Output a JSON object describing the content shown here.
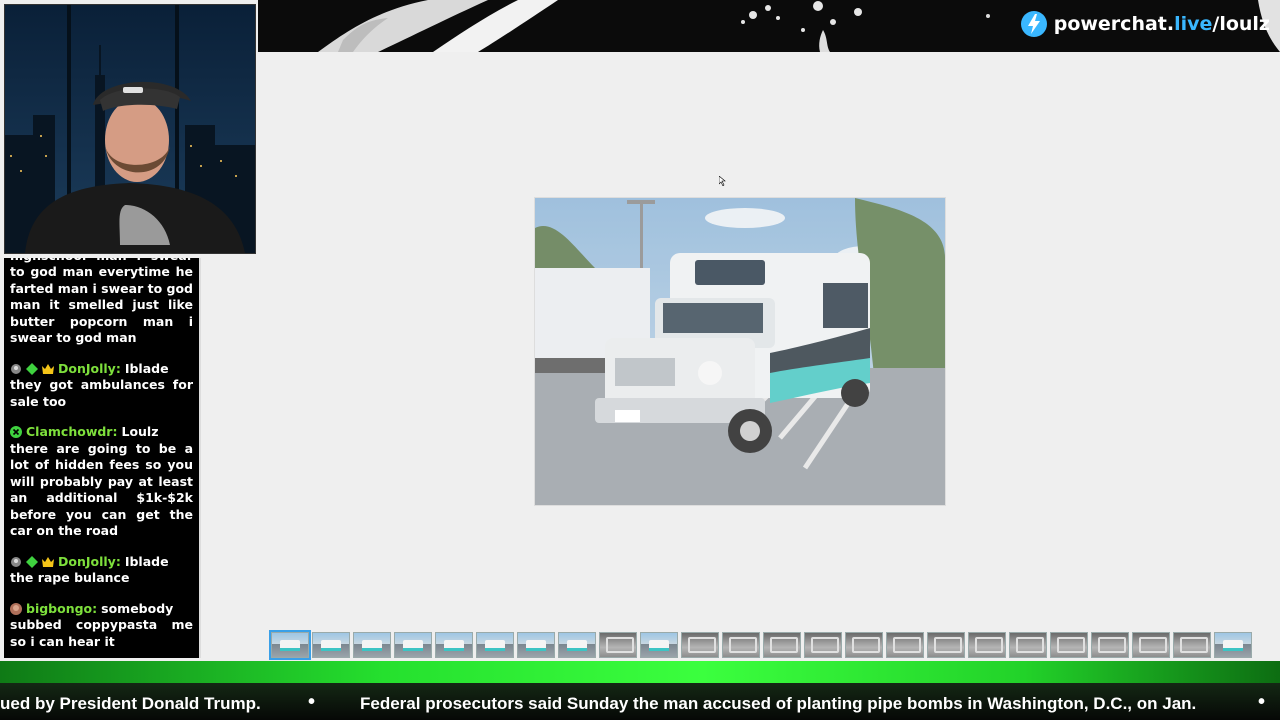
{
  "banner": {
    "brand_text_main": "powerchat.",
    "brand_text_live": "live",
    "brand_text_path": "/loulz",
    "brand_color": "#3ab7ff"
  },
  "chat": {
    "messages": [
      {
        "user": "",
        "text": "highschool man i swear to god man everytime he farted man i swear to god man it smelled just like butter popcorn man i swear to god man",
        "color": "#ffffff",
        "badges": []
      },
      {
        "user": "DonJolly:",
        "text": "Iblade they got ambulances for sale too",
        "color": "#7ee03c",
        "badges": [
          "mod-icon",
          "diamond-icon",
          "crown-icon"
        ]
      },
      {
        "user": "Clamchowdr:",
        "text": "Loulz there are going to be a lot of hidden fees so you will probably pay at least an additional $1k-$2k before you can get the car on the road",
        "color": "#7ee03c",
        "badges": [
          "x-circle-icon"
        ]
      },
      {
        "user": "DonJolly:",
        "text": "Iblade the rape bulance",
        "color": "#7ee03c",
        "badges": [
          "mod-icon",
          "diamond-icon",
          "crown-icon"
        ]
      },
      {
        "user": "bigbongo:",
        "text": "somebody subbed coppypasta me so i can hear it",
        "color": "#7ee03c",
        "badges": [
          "avatar-icon"
        ]
      }
    ]
  },
  "ticker": {
    "left_text": "ued by President Donald Trump.",
    "right_text": "Federal prosecutors said Sunday the man accused of planting pipe bombs in Washington, D.C., on Jan.",
    "separator": "•"
  },
  "gallery": {
    "thumb_count": 24,
    "active_index": 0
  }
}
